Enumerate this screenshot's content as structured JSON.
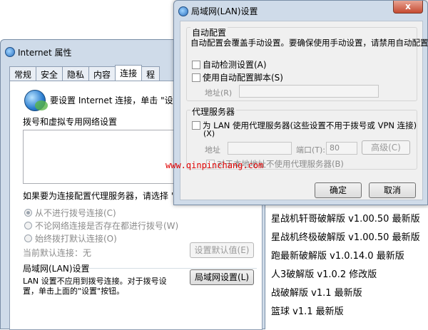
{
  "background_list": {
    "items": [
      "星战机轩哥破解版 v1.00.50 最新版",
      "星战机终极破解版 v1.00.50 最新版",
      "跑最新破解版 v1.0.14.0 最新版",
      "人3破解版 v1.0.2 修改版",
      "战破解版 v1.1 最新版",
      "篮球 v1.1 最新版"
    ]
  },
  "ie_window": {
    "title": "Internet 属性",
    "tabs": [
      "常规",
      "安全",
      "隐私",
      "内容",
      "连接",
      "程"
    ],
    "intro_text": "要设置 Internet 连接，单击 \"设置",
    "dialup_heading": "拨号和虚拟专用网络设置",
    "proxy_hint": "如果要为连接配置代理服务器，请选择 \"设",
    "radio_options": [
      "从不进行拨号连接(C)",
      "不论网络连接是否存在都进行拨号(W)",
      "始终拨打默认连接(O)"
    ],
    "current_default_label": "当前默认连接：",
    "current_default_value": "无",
    "set_default_button": "设置默认值(E)",
    "lan_heading": "局域网(LAN)设置",
    "lan_desc_line1": "LAN 设置不应用到拨号连接。对于拨号设",
    "lan_desc_line2": "置，单击上面的\"设置\"按钮。",
    "lan_button": "局域网设置(L)"
  },
  "lan_dialog": {
    "title": "局域网(LAN)设置",
    "close_label": "x",
    "auto_heading": "自动配置",
    "auto_desc": "自动配置会覆盖手动设置。要确保使用手动设置，请禁用自动配置。",
    "auto_detect_label": "自动检测设置(A)",
    "use_script_label": "使用自动配置脚本(S)",
    "address_label": "地址(R)",
    "proxy_heading": "代理服务器",
    "proxy_check_label": "为 LAN 使用代理服务器(这些设置不用于拨号或 VPN 连接)",
    "proxy_check_label2": "(X)",
    "proxy_address_label": "地址",
    "port_label": "端口(T):",
    "port_value": "80",
    "advanced_button": "高级(C)",
    "bypass_label": "对于本地地址不使用代理服务器(B)",
    "ok_button": "确定",
    "cancel_button": "取消"
  },
  "watermark": "www.qinpinchang.com"
}
